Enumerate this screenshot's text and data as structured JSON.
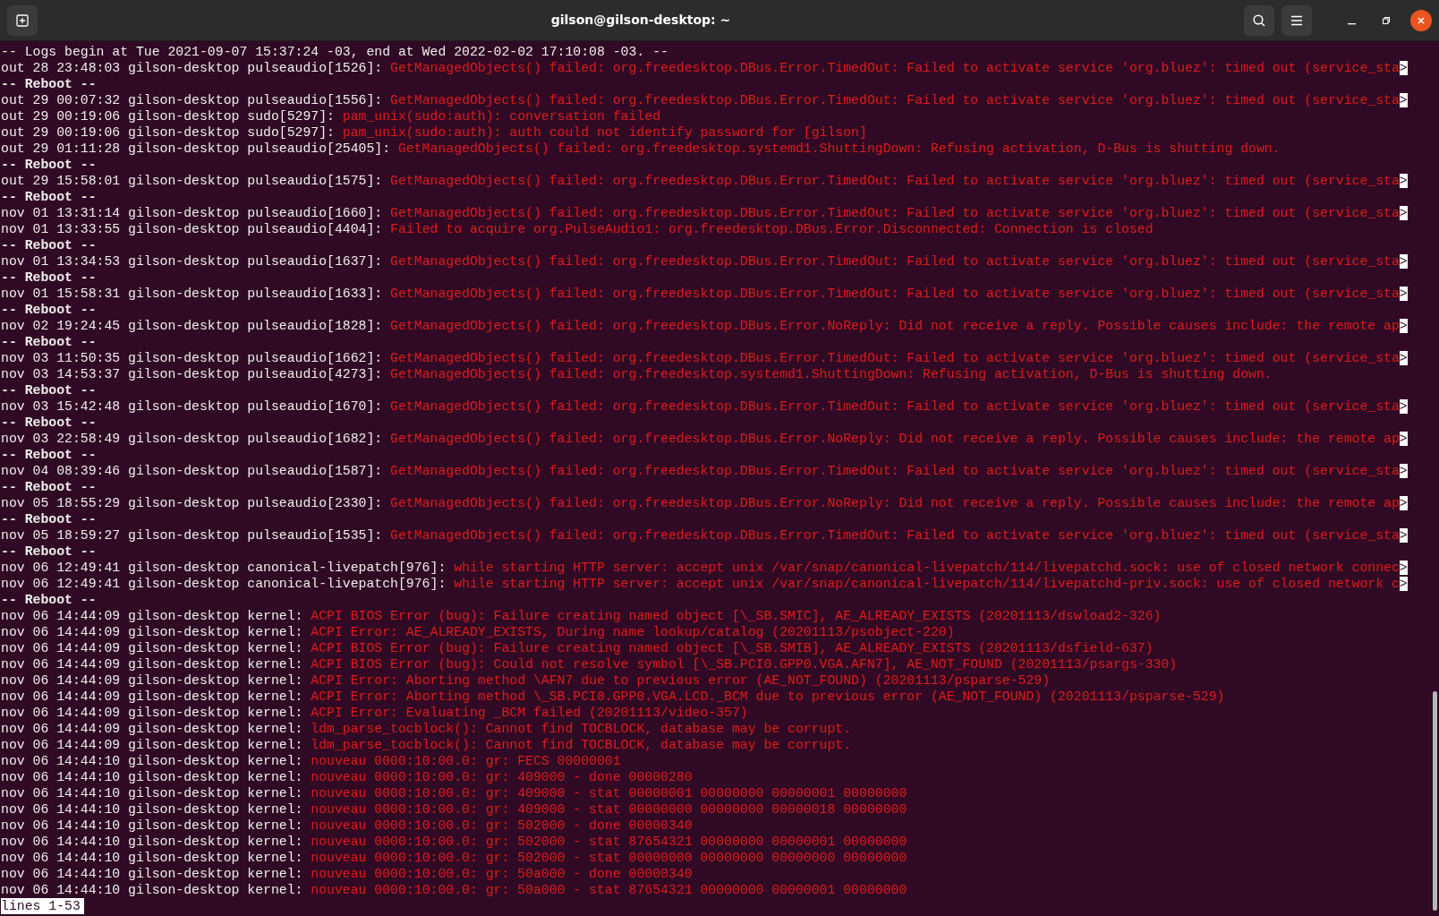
{
  "window": {
    "title": "gilson@gilson-desktop: ~"
  },
  "lines": [
    {
      "kind": "header",
      "text": "-- Logs begin at Tue 2021-09-07 15:37:24 -03, end at Wed 2022-02-02 17:10:08 -03. --"
    },
    {
      "kind": "entry",
      "source": "out 28 23:48:03 gilson-desktop pulseaudio[1526]:",
      "message": "GetManagedObjects() failed: org.freedesktop.DBus.Error.TimedOut: Failed to activate service 'org.bluez': timed out (service_sta",
      "more": ">"
    },
    {
      "kind": "reboot",
      "text": "-- Reboot --"
    },
    {
      "kind": "entry",
      "source": "out 29 00:07:32 gilson-desktop pulseaudio[1556]:",
      "message": "GetManagedObjects() failed: org.freedesktop.DBus.Error.TimedOut: Failed to activate service 'org.bluez': timed out (service_sta",
      "more": ">"
    },
    {
      "kind": "entry",
      "source": "out 29 00:19:06 gilson-desktop sudo[5297]:",
      "message": "pam_unix(sudo:auth): conversation failed"
    },
    {
      "kind": "entry",
      "source": "out 29 00:19:06 gilson-desktop sudo[5297]:",
      "message": "pam_unix(sudo:auth): auth could not identify password for [gilson]"
    },
    {
      "kind": "entry",
      "source": "out 29 01:11:28 gilson-desktop pulseaudio[25405]:",
      "message": "GetManagedObjects() failed: org.freedesktop.systemd1.ShuttingDown: Refusing activation, D-Bus is shutting down."
    },
    {
      "kind": "reboot",
      "text": "-- Reboot --"
    },
    {
      "kind": "entry",
      "source": "out 29 15:58:01 gilson-desktop pulseaudio[1575]:",
      "message": "GetManagedObjects() failed: org.freedesktop.DBus.Error.TimedOut: Failed to activate service 'org.bluez': timed out (service_sta",
      "more": ">"
    },
    {
      "kind": "reboot",
      "text": "-- Reboot --"
    },
    {
      "kind": "entry",
      "source": "nov 01 13:31:14 gilson-desktop pulseaudio[1660]:",
      "message": "GetManagedObjects() failed: org.freedesktop.DBus.Error.TimedOut: Failed to activate service 'org.bluez': timed out (service_sta",
      "more": ">"
    },
    {
      "kind": "entry",
      "source": "nov 01 13:33:55 gilson-desktop pulseaudio[4404]:",
      "message": "Failed to acquire org.PulseAudio1: org.freedesktop.DBus.Error.Disconnected: Connection is closed"
    },
    {
      "kind": "reboot",
      "text": "-- Reboot --"
    },
    {
      "kind": "entry",
      "source": "nov 01 13:34:53 gilson-desktop pulseaudio[1637]:",
      "message": "GetManagedObjects() failed: org.freedesktop.DBus.Error.TimedOut: Failed to activate service 'org.bluez': timed out (service_sta",
      "more": ">"
    },
    {
      "kind": "reboot",
      "text": "-- Reboot --"
    },
    {
      "kind": "entry",
      "source": "nov 01 15:58:31 gilson-desktop pulseaudio[1633]:",
      "message": "GetManagedObjects() failed: org.freedesktop.DBus.Error.TimedOut: Failed to activate service 'org.bluez': timed out (service_sta",
      "more": ">"
    },
    {
      "kind": "reboot",
      "text": "-- Reboot --"
    },
    {
      "kind": "entry",
      "source": "nov 02 19:24:45 gilson-desktop pulseaudio[1828]:",
      "message": "GetManagedObjects() failed: org.freedesktop.DBus.Error.NoReply: Did not receive a reply. Possible causes include: the remote ap",
      "more": ">"
    },
    {
      "kind": "reboot",
      "text": "-- Reboot --"
    },
    {
      "kind": "entry",
      "source": "nov 03 11:50:35 gilson-desktop pulseaudio[1662]:",
      "message": "GetManagedObjects() failed: org.freedesktop.DBus.Error.TimedOut: Failed to activate service 'org.bluez': timed out (service_sta",
      "more": ">"
    },
    {
      "kind": "entry",
      "source": "nov 03 14:53:37 gilson-desktop pulseaudio[4273]:",
      "message": "GetManagedObjects() failed: org.freedesktop.systemd1.ShuttingDown: Refusing activation, D-Bus is shutting down."
    },
    {
      "kind": "reboot",
      "text": "-- Reboot --"
    },
    {
      "kind": "entry",
      "source": "nov 03 15:42:48 gilson-desktop pulseaudio[1670]:",
      "message": "GetManagedObjects() failed: org.freedesktop.DBus.Error.TimedOut: Failed to activate service 'org.bluez': timed out (service_sta",
      "more": ">"
    },
    {
      "kind": "reboot",
      "text": "-- Reboot --"
    },
    {
      "kind": "entry",
      "source": "nov 03 22:58:49 gilson-desktop pulseaudio[1682]:",
      "message": "GetManagedObjects() failed: org.freedesktop.DBus.Error.NoReply: Did not receive a reply. Possible causes include: the remote ap",
      "more": ">"
    },
    {
      "kind": "reboot",
      "text": "-- Reboot --"
    },
    {
      "kind": "entry",
      "source": "nov 04 08:39:46 gilson-desktop pulseaudio[1587]:",
      "message": "GetManagedObjects() failed: org.freedesktop.DBus.Error.TimedOut: Failed to activate service 'org.bluez': timed out (service_sta",
      "more": ">"
    },
    {
      "kind": "reboot",
      "text": "-- Reboot --"
    },
    {
      "kind": "entry",
      "source": "nov 05 18:55:29 gilson-desktop pulseaudio[2330]:",
      "message": "GetManagedObjects() failed: org.freedesktop.DBus.Error.NoReply: Did not receive a reply. Possible causes include: the remote ap",
      "more": ">"
    },
    {
      "kind": "reboot",
      "text": "-- Reboot --"
    },
    {
      "kind": "entry",
      "source": "nov 05 18:59:27 gilson-desktop pulseaudio[1535]:",
      "message": "GetManagedObjects() failed: org.freedesktop.DBus.Error.TimedOut: Failed to activate service 'org.bluez': timed out (service_sta",
      "more": ">"
    },
    {
      "kind": "reboot",
      "text": "-- Reboot --"
    },
    {
      "kind": "entry",
      "source": "nov 06 12:49:41 gilson-desktop canonical-livepatch[976]:",
      "message": "while starting HTTP server: accept unix /var/snap/canonical-livepatch/114/livepatchd.sock: use of closed network connec",
      "more": ">"
    },
    {
      "kind": "entry",
      "source": "nov 06 12:49:41 gilson-desktop canonical-livepatch[976]:",
      "message": "while starting HTTP server: accept unix /var/snap/canonical-livepatch/114/livepatchd-priv.sock: use of closed network c",
      "more": ">"
    },
    {
      "kind": "reboot",
      "text": "-- Reboot --"
    },
    {
      "kind": "entry",
      "source": "nov 06 14:44:09 gilson-desktop kernel:",
      "message": "ACPI BIOS Error (bug): Failure creating named object [\\_SB.SMIC], AE_ALREADY_EXISTS (20201113/dswload2-326)"
    },
    {
      "kind": "entry",
      "source": "nov 06 14:44:09 gilson-desktop kernel:",
      "message": "ACPI Error: AE_ALREADY_EXISTS, During name lookup/catalog (20201113/psobject-220)"
    },
    {
      "kind": "entry",
      "source": "nov 06 14:44:09 gilson-desktop kernel:",
      "message": "ACPI BIOS Error (bug): Failure creating named object [\\_SB.SMIB], AE_ALREADY_EXISTS (20201113/dsfield-637)"
    },
    {
      "kind": "entry",
      "source": "nov 06 14:44:09 gilson-desktop kernel:",
      "message": "ACPI BIOS Error (bug): Could not resolve symbol [\\_SB.PCI0.GPP0.VGA.AFN7], AE_NOT_FOUND (20201113/psargs-330)"
    },
    {
      "kind": "entry",
      "source": "nov 06 14:44:09 gilson-desktop kernel:",
      "message": "ACPI Error: Aborting method \\AFN7 due to previous error (AE_NOT_FOUND) (20201113/psparse-529)"
    },
    {
      "kind": "entry",
      "source": "nov 06 14:44:09 gilson-desktop kernel:",
      "message": "ACPI Error: Aborting method \\_SB.PCI0.GPP0.VGA.LCD._BCM due to previous error (AE_NOT_FOUND) (20201113/psparse-529)"
    },
    {
      "kind": "entry",
      "source": "nov 06 14:44:09 gilson-desktop kernel:",
      "message": "ACPI Error: Evaluating _BCM failed (20201113/video-357)"
    },
    {
      "kind": "entry",
      "source": "nov 06 14:44:09 gilson-desktop kernel:",
      "message": "ldm_parse_tocblock(): Cannot find TOCBLOCK, database may be corrupt."
    },
    {
      "kind": "entry",
      "source": "nov 06 14:44:09 gilson-desktop kernel:",
      "message": "ldm_parse_tocblock(): Cannot find TOCBLOCK, database may be corrupt."
    },
    {
      "kind": "entry",
      "source": "nov 06 14:44:10 gilson-desktop kernel:",
      "message": "nouveau 0000:10:00.0: gr: FECS 00000001"
    },
    {
      "kind": "entry",
      "source": "nov 06 14:44:10 gilson-desktop kernel:",
      "message": "nouveau 0000:10:00.0: gr: 409000 - done 00000280"
    },
    {
      "kind": "entry",
      "source": "nov 06 14:44:10 gilson-desktop kernel:",
      "message": "nouveau 0000:10:00.0: gr: 409000 - stat 00000001 00000000 00000001 00000000"
    },
    {
      "kind": "entry",
      "source": "nov 06 14:44:10 gilson-desktop kernel:",
      "message": "nouveau 0000:10:00.0: gr: 409000 - stat 00000000 00000000 00000018 00000000"
    },
    {
      "kind": "entry",
      "source": "nov 06 14:44:10 gilson-desktop kernel:",
      "message": "nouveau 0000:10:00.0: gr: 502000 - done 00000340"
    },
    {
      "kind": "entry",
      "source": "nov 06 14:44:10 gilson-desktop kernel:",
      "message": "nouveau 0000:10:00.0: gr: 502000 - stat 87654321 00000000 00000001 00000000"
    },
    {
      "kind": "entry",
      "source": "nov 06 14:44:10 gilson-desktop kernel:",
      "message": "nouveau 0000:10:00.0: gr: 502000 - stat 00000000 00000000 00000000 00000000"
    },
    {
      "kind": "entry",
      "source": "nov 06 14:44:10 gilson-desktop kernel:",
      "message": "nouveau 0000:10:00.0: gr: 50a000 - done 00000340"
    },
    {
      "kind": "entry",
      "source": "nov 06 14:44:10 gilson-desktop kernel:",
      "message": "nouveau 0000:10:00.0: gr: 50a000 - stat 87654321 00000000 00000001 00000000"
    }
  ],
  "status_line": "lines 1-53"
}
